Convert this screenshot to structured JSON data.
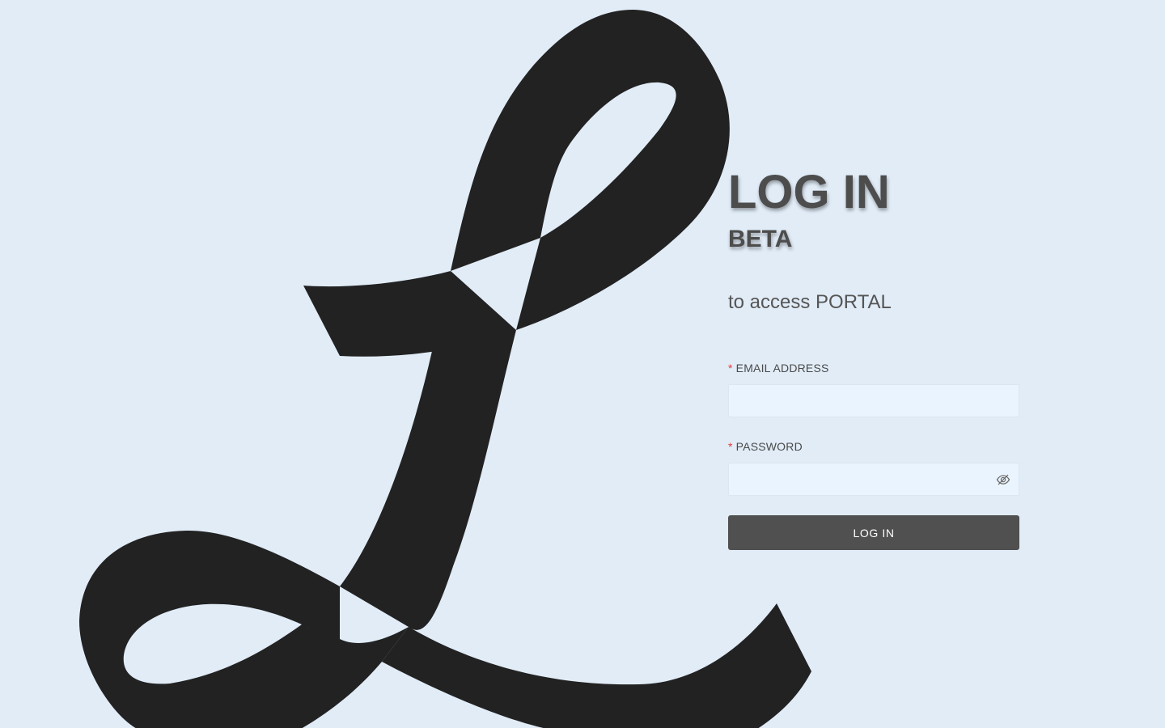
{
  "login": {
    "title": "LOG IN",
    "subtitle": "BETA",
    "access_text": "to access PORTAL",
    "email": {
      "required_marker": "*",
      "label": "EMAIL ADDRESS",
      "value": "",
      "placeholder": ""
    },
    "password": {
      "required_marker": "*",
      "label": "PASSWORD",
      "value": "",
      "placeholder": "",
      "toggle_icon": "eye-slash-icon"
    },
    "submit_label": "LOG IN"
  },
  "branding": {
    "logo_icon": "script-l-logo",
    "logo_color": "#222222"
  },
  "colors": {
    "background": "#e1ecf7",
    "input_background": "#eaf4fe",
    "button_background": "#505050",
    "heading_text": "#4d4d4d",
    "required_marker": "#e53935"
  }
}
